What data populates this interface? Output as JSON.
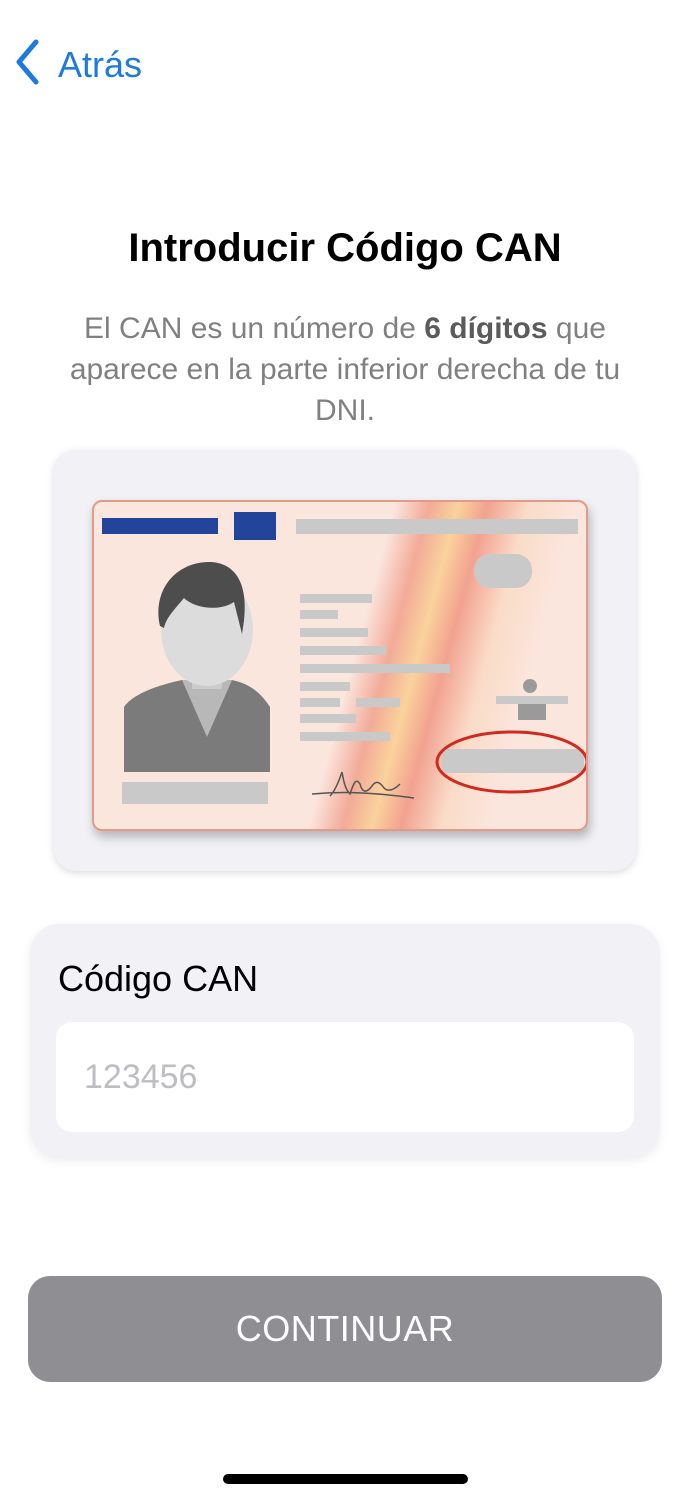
{
  "nav": {
    "back_label": "Atrás",
    "back_icon": "chevron-left-icon",
    "accent_color": "#1f7ae0"
  },
  "header": {
    "title": "Introducir Código CAN",
    "description_before": "El CAN es un número de ",
    "description_bold": "6 dígitos",
    "description_after": " que aparece en la parte inferior derecha de tu DNI."
  },
  "can_form": {
    "label": "Código CAN",
    "input_value": "",
    "input_placeholder": "123456"
  },
  "actions": {
    "continue_label": "CONTINUAR",
    "continue_color": "#8e8e93"
  }
}
